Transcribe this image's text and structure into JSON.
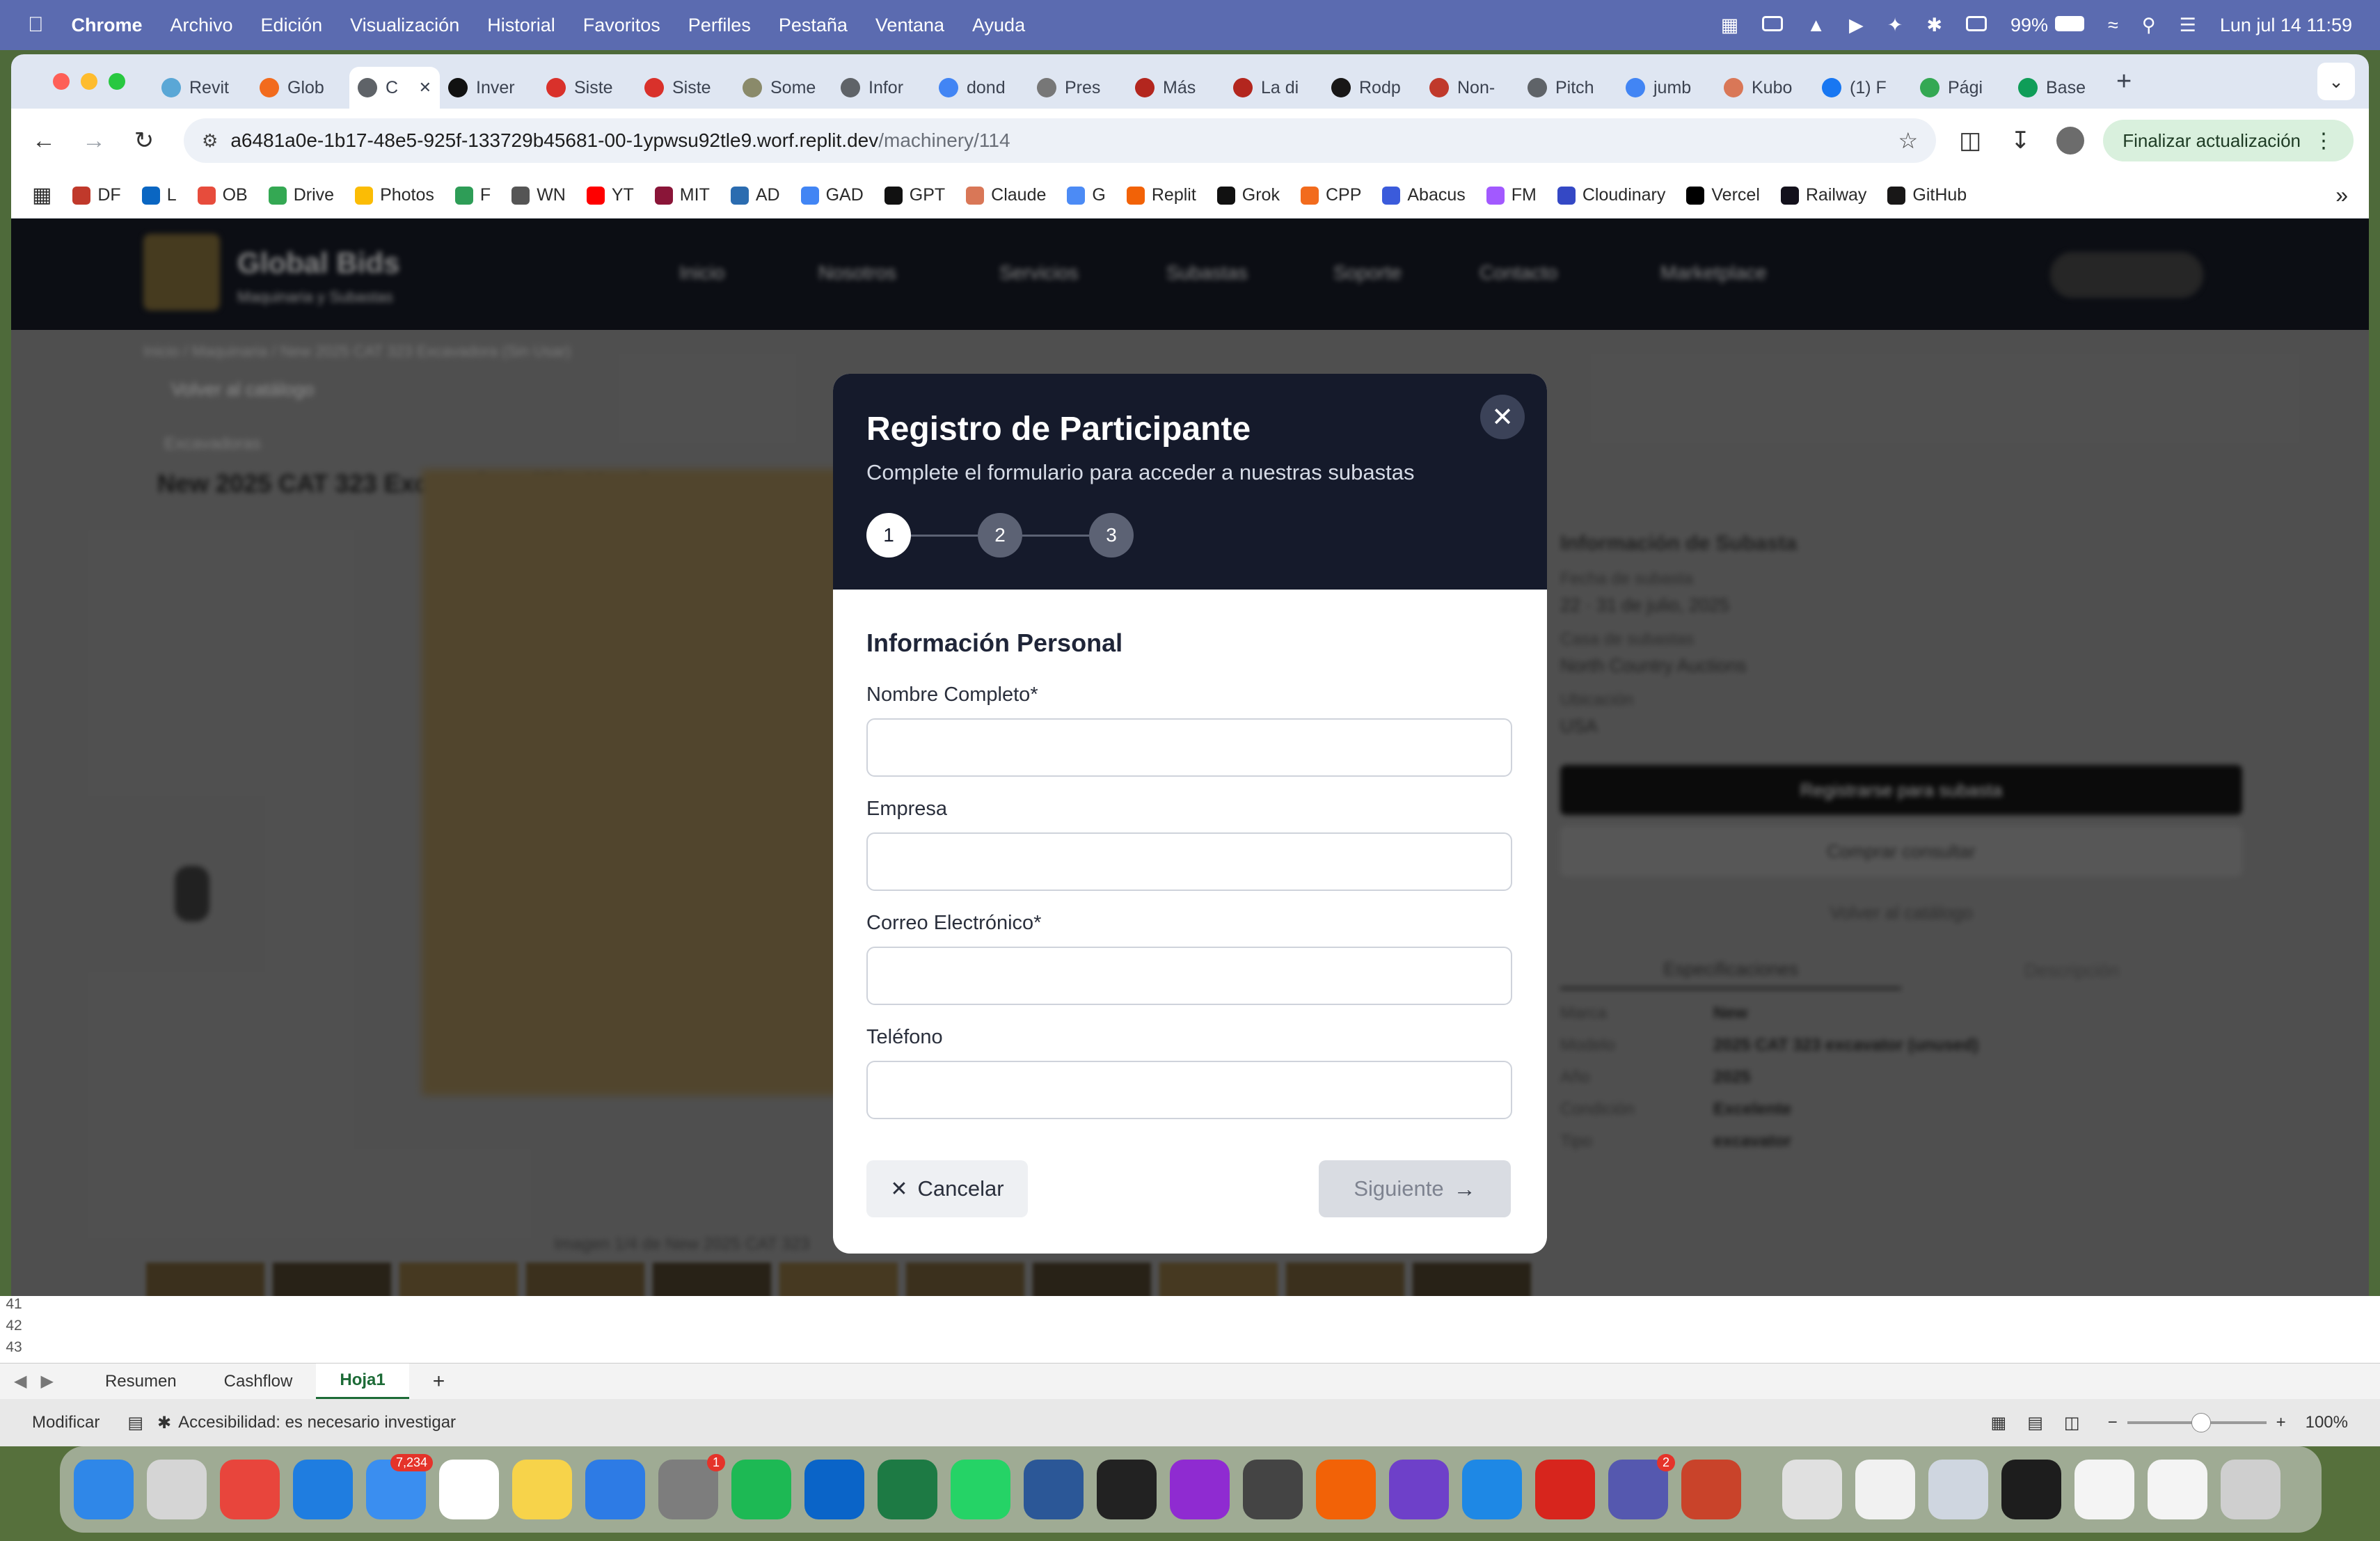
{
  "menubar": {
    "app": "Chrome",
    "items": [
      "Archivo",
      "Edición",
      "Visualización",
      "Historial",
      "Favoritos",
      "Perfiles",
      "Pestaña",
      "Ventana",
      "Ayuda"
    ],
    "battery": "99%",
    "datetime": "Lun jul 14  11:59"
  },
  "tabs": [
    {
      "label": "Revit",
      "color": "#5aa7d6"
    },
    {
      "label": "Glob",
      "color": "#f26b1d"
    },
    {
      "label": "C",
      "color": "#5f6368",
      "active": true
    },
    {
      "label": "Inver",
      "color": "#111111"
    },
    {
      "label": "Siste",
      "color": "#d9312b"
    },
    {
      "label": "Siste",
      "color": "#d9312b"
    },
    {
      "label": "Some",
      "color": "#8a8a6a"
    },
    {
      "label": "Infor",
      "color": "#5f6368"
    },
    {
      "label": "dond",
      "color": "#4285f4"
    },
    {
      "label": "Pres",
      "color": "#777777"
    },
    {
      "label": "Más",
      "color": "#b3261e"
    },
    {
      "label": "La di",
      "color": "#b3261e"
    },
    {
      "label": "Rodp",
      "color": "#181717"
    },
    {
      "label": "Non-",
      "color": "#c0392b"
    },
    {
      "label": "Pitch",
      "color": "#5f6368"
    },
    {
      "label": "jumb",
      "color": "#4285f4"
    },
    {
      "label": "Kubo",
      "color": "#d97757"
    },
    {
      "label": "(1) F",
      "color": "#1877f2"
    },
    {
      "label": "Pági",
      "color": "#34a853"
    },
    {
      "label": "Base",
      "color": "#0f9d58"
    }
  ],
  "toolbar": {
    "url_host": "a6481a0e-1b17-48e5-925f-133729b45681-00-1ypwsu92tle9.worf.replit.dev",
    "url_path": "/machinery/114",
    "update_label": "Finalizar actualización"
  },
  "bookmarks": [
    {
      "label": "DF",
      "color": "#c0392b"
    },
    {
      "label": "L",
      "color": "#0a66c2"
    },
    {
      "label": "OB",
      "color": "#e74c3c"
    },
    {
      "label": "Drive",
      "color": "#34a853"
    },
    {
      "label": "Photos",
      "color": "#fbbc05"
    },
    {
      "label": "F",
      "color": "#2e9d57"
    },
    {
      "label": "WN",
      "color": "#555555"
    },
    {
      "label": "YT",
      "color": "#ff0000"
    },
    {
      "label": "MIT",
      "color": "#8a1538"
    },
    {
      "label": "AD",
      "color": "#2b6cb0"
    },
    {
      "label": "GAD",
      "color": "#4285f4"
    },
    {
      "label": "GPT",
      "color": "#111111"
    },
    {
      "label": "Claude",
      "color": "#d97757"
    },
    {
      "label": "G",
      "color": "#4c8bf5"
    },
    {
      "label": "Replit",
      "color": "#f26207"
    },
    {
      "label": "Grok",
      "color": "#111111"
    },
    {
      "label": "CPP",
      "color": "#f26b1d"
    },
    {
      "label": "Abacus",
      "color": "#3b5bdb"
    },
    {
      "label": "FM",
      "color": "#a259ff"
    },
    {
      "label": "Cloudinary",
      "color": "#3448c5"
    },
    {
      "label": "Vercel",
      "color": "#000000"
    },
    {
      "label": "Railway",
      "color": "#13111c"
    },
    {
      "label": "GitHub",
      "color": "#181717"
    }
  ],
  "site": {
    "brand": "Global Bids",
    "brand_sub": "Maquinaria y Subastas",
    "nav": [
      "Inicio",
      "Nosotros",
      "Servicios",
      "Subastas",
      "Soporte",
      "Contacto",
      "Marketplace"
    ],
    "breadcrumb": "Inicio / Maquinaria / New 2025 CAT 323 Excavadora (Sin Usar)",
    "back": "Volver al catálogo",
    "category": "Excavadoras",
    "product_title": "New 2025 CAT 323 Excavadora (Sin Usar)",
    "side_title": "Información de Subasta",
    "side_rows": [
      "Fecha de subasta",
      "22 · 31 de julio, 2025",
      "Casa de subastas",
      "North Country Auctions",
      "Ubicación",
      "USA"
    ],
    "side_btn1": "Registrarse para subasta",
    "side_btn2": "Comprar consultar",
    "side_btn3": "Volver al catálogo",
    "side_tabs": [
      "Especificaciones",
      "Descripción"
    ],
    "spec_rows": [
      "Marca",
      "New",
      "Modelo",
      "2025 CAT 323 excavator (unused)",
      "Año",
      "2025",
      "Condición",
      "Excelente",
      "Tipo",
      "excavator"
    ],
    "caption": "Imagen 1/4 de New 2025 CAT 323"
  },
  "modal": {
    "title": "Registro de Participante",
    "subtitle": "Complete el formulario para acceder a nuestras subastas",
    "steps": [
      "1",
      "2",
      "3"
    ],
    "section_title": "Información Personal",
    "fields": [
      {
        "label": "Nombre Completo*",
        "value": "",
        "placeholder": ""
      },
      {
        "label": "Empresa",
        "value": "",
        "placeholder": ""
      },
      {
        "label": "Correo Electrónico*",
        "value": "",
        "placeholder": ""
      },
      {
        "label": "Teléfono",
        "value": "",
        "placeholder": ""
      }
    ],
    "cancel_label": "Cancelar",
    "next_label": "Siguiente"
  },
  "excel": {
    "rows": [
      "41",
      "42",
      "43"
    ],
    "sheets": [
      "Resumen",
      "Cashflow",
      "Hoja1"
    ],
    "active_sheet": "Hoja1",
    "status_mode": "Modificar",
    "accessibility": "Accesibilidad: es necesario investigar",
    "zoom": "100%"
  },
  "dock": [
    {
      "name": "finder",
      "color": "#2f87e8",
      "badge": ""
    },
    {
      "name": "launchpad",
      "color": "#d5d5d5",
      "badge": ""
    },
    {
      "name": "chrome",
      "color": "#e8453c",
      "badge": ""
    },
    {
      "name": "safari",
      "color": "#1f7de0",
      "badge": ""
    },
    {
      "name": "mail",
      "color": "#3a8ef0",
      "badge": "7,234"
    },
    {
      "name": "calendar",
      "color": "#ffffff",
      "badge": ""
    },
    {
      "name": "notes",
      "color": "#f7d34a",
      "badge": ""
    },
    {
      "name": "keynote",
      "color": "#2d7be5",
      "badge": ""
    },
    {
      "name": "system-settings",
      "color": "#7d7d7d",
      "badge": "1"
    },
    {
      "name": "spotify",
      "color": "#1db954",
      "badge": ""
    },
    {
      "name": "outlook",
      "color": "#0a64c8",
      "badge": ""
    },
    {
      "name": "excel",
      "color": "#1d7a44",
      "badge": ""
    },
    {
      "name": "whatsapp",
      "color": "#25d366",
      "badge": ""
    },
    {
      "name": "word",
      "color": "#2b5797",
      "badge": ""
    },
    {
      "name": "calendar-31",
      "color": "#222222",
      "badge": ""
    },
    {
      "name": "orbit",
      "color": "#8f2bd1",
      "badge": ""
    },
    {
      "name": "iphone-mirroring",
      "color": "#444444",
      "badge": ""
    },
    {
      "name": "replit",
      "color": "#f26207",
      "badge": ""
    },
    {
      "name": "github-desktop",
      "color": "#6e40c9",
      "badge": ""
    },
    {
      "name": "vscode",
      "color": "#1e88e5",
      "badge": ""
    },
    {
      "name": "acrobat",
      "color": "#d7251d",
      "badge": ""
    },
    {
      "name": "teams",
      "color": "#5558af",
      "badge": "2"
    },
    {
      "name": "powerpoint-recorder",
      "color": "#c9432a",
      "badge": ""
    },
    {
      "name": "files",
      "color": "#e0e0e0",
      "badge": ""
    },
    {
      "name": "pdf-window",
      "color": "#f1f1f1",
      "badge": ""
    },
    {
      "name": "window-preview",
      "color": "#cfd6e0",
      "badge": ""
    },
    {
      "name": "terminal-window",
      "color": "#1d1d1d",
      "badge": ""
    },
    {
      "name": "window-blank",
      "color": "#f4f4f4",
      "badge": ""
    },
    {
      "name": "window-blank-2",
      "color": "#f4f4f4",
      "badge": ""
    },
    {
      "name": "trash",
      "color": "#cfcfcf",
      "badge": ""
    }
  ],
  "colors": {
    "modal_header": "#151a2b",
    "accent": "#151a2b",
    "excel_green": "#1d6b37"
  }
}
